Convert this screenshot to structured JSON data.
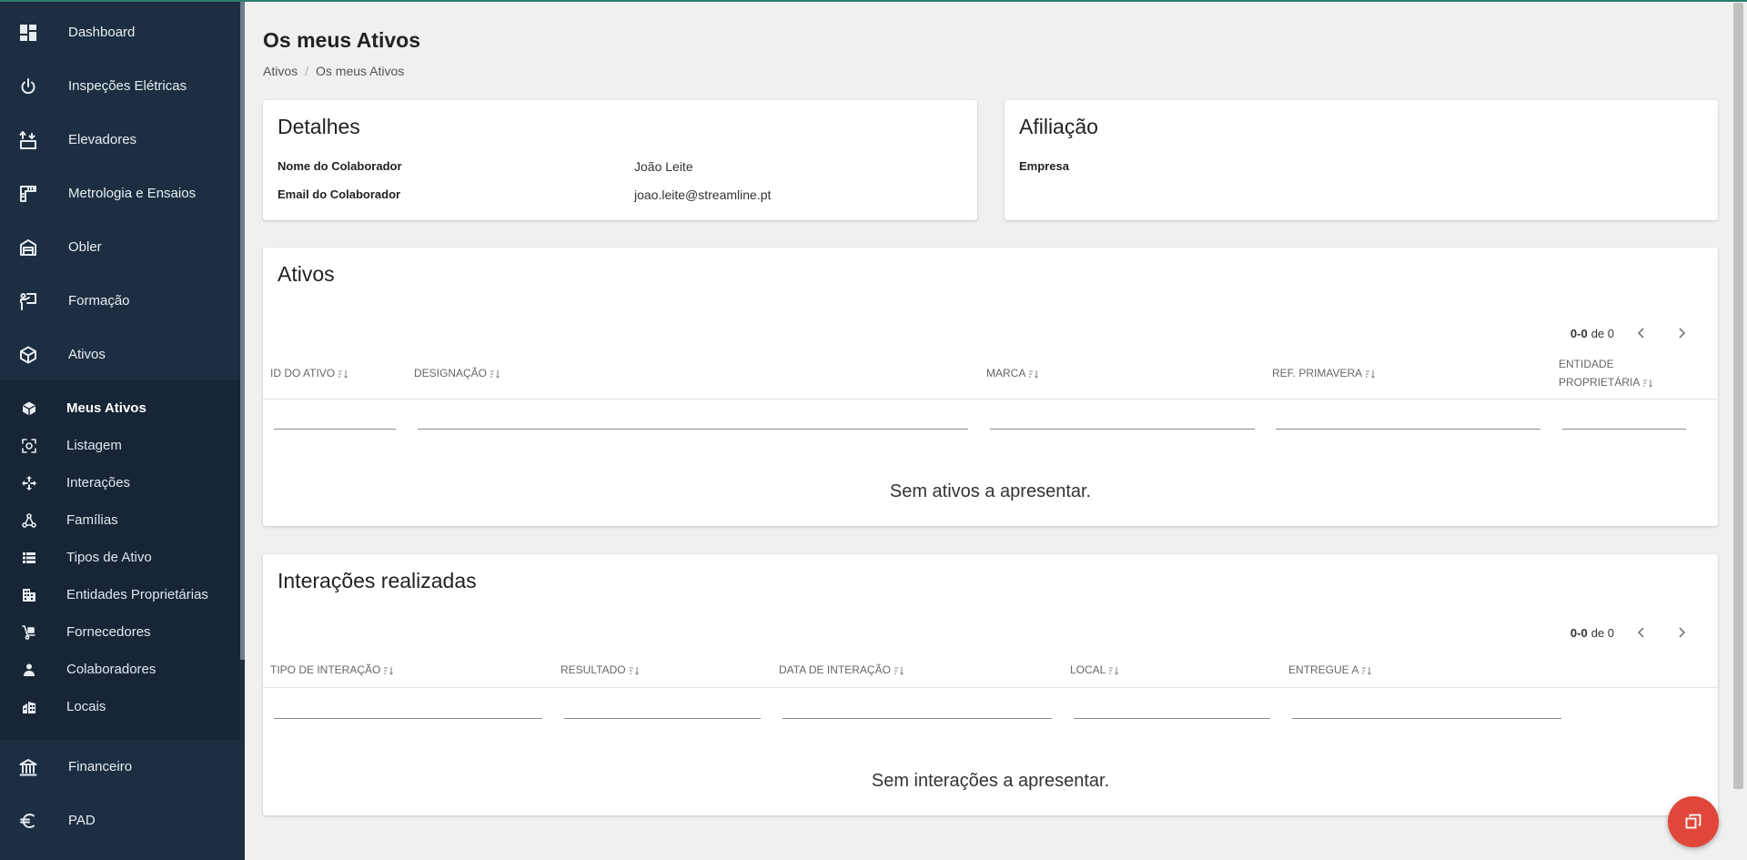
{
  "sidebar": {
    "items": [
      {
        "label": "Dashboard",
        "icon": "dashboard-icon"
      },
      {
        "label": "Inspeções Elétricas",
        "icon": "power-icon"
      },
      {
        "label": "Elevadores",
        "icon": "elevator-icon"
      },
      {
        "label": "Metrologia e Ensaios",
        "icon": "ruler-icon"
      },
      {
        "label": "Obler",
        "icon": "factory-icon"
      },
      {
        "label": "Formação",
        "icon": "presentation-icon"
      },
      {
        "label": "Ativos",
        "icon": "cube-icon"
      }
    ],
    "subitems": [
      {
        "label": "Meus Ativos",
        "icon": "cube-filled-icon",
        "active": true
      },
      {
        "label": "Listagem",
        "icon": "scan-icon"
      },
      {
        "label": "Interações",
        "icon": "move-icon"
      },
      {
        "label": "Famílias",
        "icon": "hierarchy-icon"
      },
      {
        "label": "Tipos de Ativo",
        "icon": "list-icon"
      },
      {
        "label": "Entidades Proprietárias",
        "icon": "building-icon"
      },
      {
        "label": "Fornecedores",
        "icon": "dolly-icon"
      },
      {
        "label": "Colaboradores",
        "icon": "person-icon"
      },
      {
        "label": "Locais",
        "icon": "city-icon"
      }
    ],
    "bottom_items": [
      {
        "label": "Financeiro",
        "icon": "bank-icon"
      },
      {
        "label": "PAD",
        "icon": "euro-icon"
      }
    ]
  },
  "page": {
    "title": "Os meus Ativos",
    "breadcrumb": [
      "Ativos",
      "Os meus Ativos"
    ],
    "breadcrumb_sep": "/"
  },
  "details": {
    "title": "Detalhes",
    "rows": [
      {
        "label": "Nome do Colaborador",
        "value": "João Leite"
      },
      {
        "label": "Email do Colaborador",
        "value": "joao.leite@streamline.pt"
      }
    ]
  },
  "affiliation": {
    "title": "Afiliação",
    "label": "Empresa"
  },
  "assets": {
    "title": "Ativos",
    "pager_range": "0-0",
    "pager_total": "de 0",
    "columns": [
      "ID DO ATIVO",
      "DESIGNAÇÃO",
      "MARCA",
      "REF. PRIMAVERA",
      "ENTIDADE PROPRIETÁRIA"
    ],
    "empty_message": "Sem ativos a apresentar."
  },
  "interactions": {
    "title": "Interações realizadas",
    "pager_range": "0-0",
    "pager_total": "de 0",
    "columns": [
      "TIPO DE INTERAÇÃO",
      "RESULTADO",
      "DATA DE INTERAÇÃO",
      "LOCAL",
      "ENTREGUE A"
    ],
    "empty_message": "Sem interações a apresentar."
  },
  "colors": {
    "sidebar_bg": "#1e2e42",
    "sidebar_sub_bg": "#172536",
    "fab": "#e0473a",
    "accent": "#2e7d6b"
  }
}
